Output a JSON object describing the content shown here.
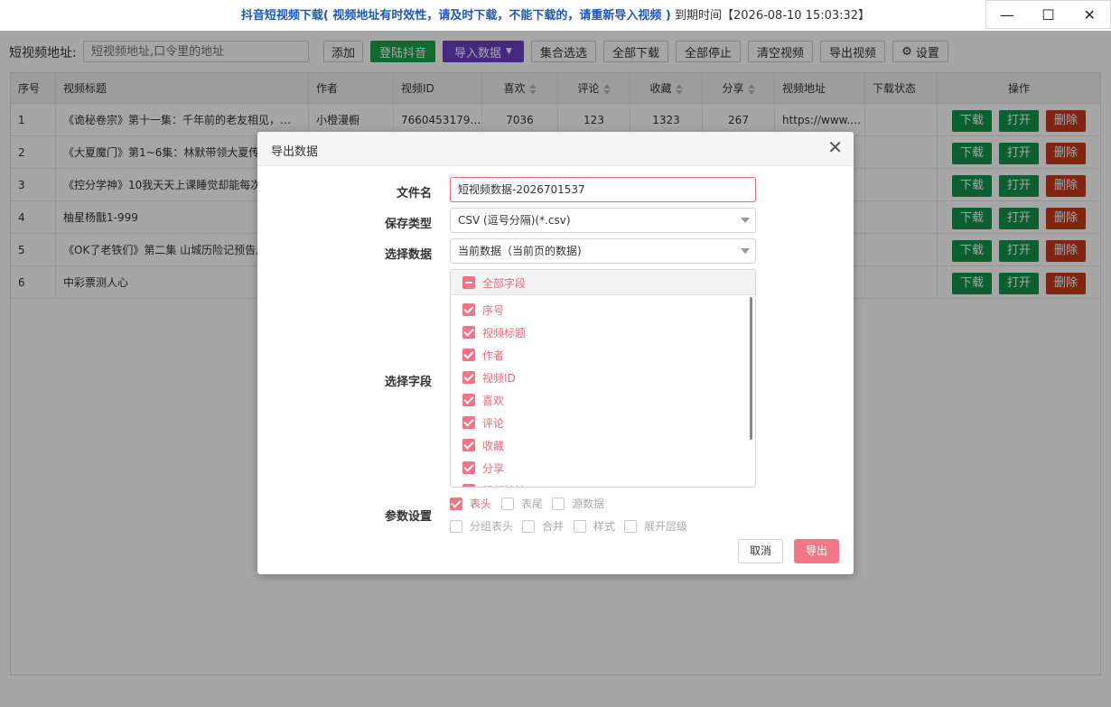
{
  "window": {
    "title_main": "抖音短视频下载( 视频地址有时效性，请及时下载，不能下载的，请重新导入视频 )",
    "title_expiry": "到期时间【2026-08-10 15:03:32】",
    "controls": {
      "minimize": "—",
      "maximize": "☐",
      "close": "✕"
    }
  },
  "toolbar": {
    "url_label": "短视频地址:",
    "url_placeholder": "短视频地址,口令里的地址",
    "add": "添加",
    "login": "登陆抖音",
    "import": "导入数据",
    "import_icon": "chevron-down-icon",
    "select_set": "集合选选",
    "download_all": "全部下载",
    "stop_all": "全部停止",
    "clear": "清空视频",
    "export_video": "导出视频",
    "settings": "设置",
    "settings_icon": "gear-icon"
  },
  "table": {
    "columns": [
      "序号",
      "视频标题",
      "作者",
      "视频ID",
      "喜欢",
      "评论",
      "收藏",
      "分享",
      "视频地址",
      "下载状态",
      "操作"
    ],
    "rows": [
      {
        "index": "1",
        "title": "《诡秘卷宗》第十一集：千年前的老友相见，…",
        "author": "小橙漫橱",
        "video_id": "7660453179…",
        "likes": "7036",
        "comments": "123",
        "favorites": "1323",
        "shares": "267",
        "url": "https://www.…",
        "status": ""
      },
      {
        "index": "2",
        "title": "《大夏魔门》第1~6集：林默带领大夏传",
        "author": "",
        "video_id": "",
        "likes": "",
        "comments": "",
        "favorites": "",
        "shares": "",
        "url": "",
        "status": ""
      },
      {
        "index": "3",
        "title": "《控分学神》10我天天上课睡觉却能每次",
        "author": "",
        "video_id": "",
        "likes": "",
        "comments": "",
        "favorites": "",
        "shares": "",
        "url": "",
        "status": ""
      },
      {
        "index": "4",
        "title": "柚星杨戬1-999",
        "author": "",
        "video_id": "",
        "likes": "",
        "comments": "",
        "favorites": "",
        "shares": "",
        "url": "",
        "status": ""
      },
      {
        "index": "5",
        "title": "《OK了老铁们》第二集 山城历险记预告片",
        "author": "",
        "video_id": "",
        "likes": "",
        "comments": "",
        "favorites": "",
        "shares": "",
        "url": "",
        "status": ""
      },
      {
        "index": "6",
        "title": "中彩票测人心",
        "author": "",
        "video_id": "",
        "likes": "",
        "comments": "",
        "favorites": "",
        "shares": "",
        "url": "",
        "status": ""
      }
    ],
    "actions": {
      "download": "下载",
      "open": "打开",
      "delete": "删除"
    }
  },
  "dialog": {
    "title": "导出数据",
    "filename_label": "文件名",
    "filename_value": "短视频数据-2026701537",
    "save_type_label": "保存类型",
    "save_type_value": "CSV (逗号分隔)(*.csv)",
    "data_label": "选择数据",
    "data_value": "当前数据（当前页的数据)",
    "fields_label": "选择字段",
    "all_fields": "全部字段",
    "fields": [
      "序号",
      "视频标题",
      "作者",
      "视频ID",
      "喜欢",
      "评论",
      "收藏",
      "分享",
      "视频地址"
    ],
    "params_label": "参数设置",
    "params": {
      "header": "表头",
      "footer": "表尾",
      "source": "源数据",
      "group_header": "分组表头",
      "merge": "合并",
      "style": "样式",
      "expand": "展开层级"
    },
    "cancel": "取消",
    "export": "导出"
  },
  "colors": {
    "green": "#17a349",
    "purple": "#6a3fc4",
    "delete_red": "#c33a1d",
    "accent_pink": "#f07888",
    "title_blue": "#1e57b8"
  }
}
